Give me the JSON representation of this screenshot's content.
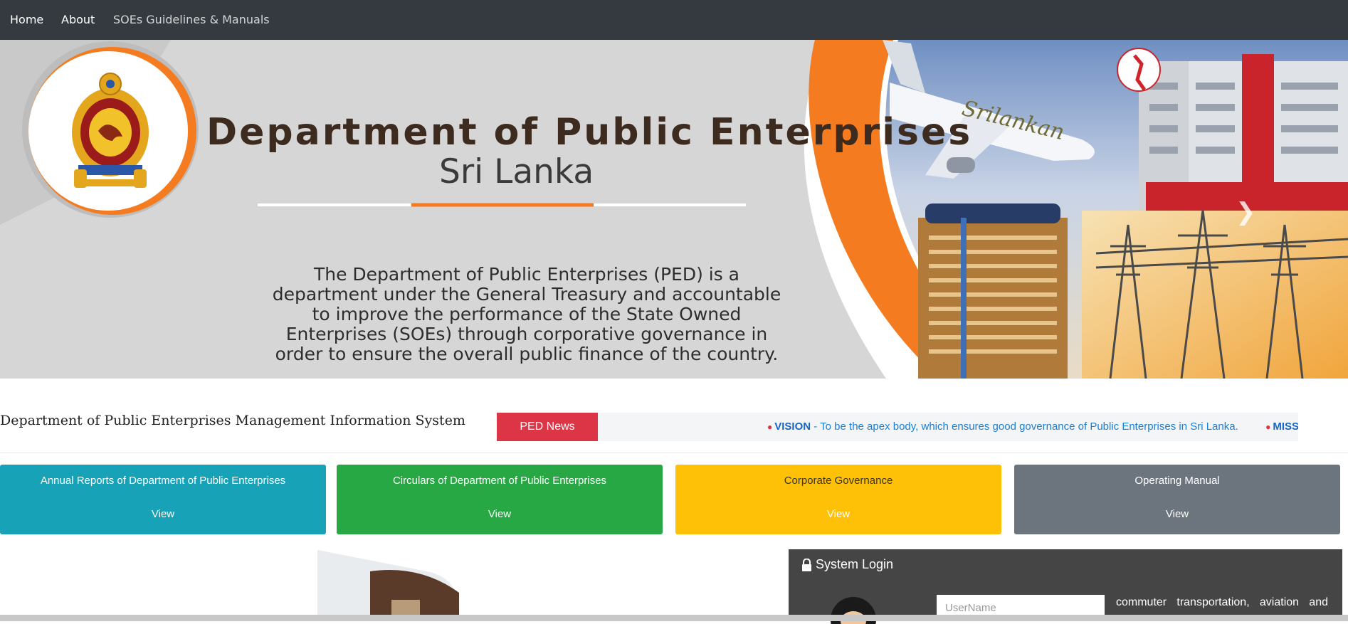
{
  "nav": {
    "items": [
      "Home",
      "About",
      "SOEs Guidelines & Manuals"
    ]
  },
  "banner": {
    "title": "Department of Public Enterprises",
    "subtitle": "Sri Lanka",
    "description": "The Department of Public Enterprises (PED) is a department under the General Treasury and accountable to improve the performance of the State Owned Enterprises (SOEs) through corporative governance in order to ensure the overall public finance of the country.",
    "plane_text": "Srilankan",
    "accent_color": "#f47b20"
  },
  "mis_title": "Department of Public Enterprises Management Information System",
  "news": {
    "label": "PED News",
    "items": [
      {
        "heading": "VISION",
        "text": " - To be the apex body, which ensures good governance of Public Enterprises in Sri Lanka."
      },
      {
        "heading": "MISSION",
        "text": ""
      }
    ]
  },
  "cards": [
    {
      "title": "Annual Reports of Department of Public Enterprises",
      "action": "View",
      "color": "#17a2b8"
    },
    {
      "title": "Circulars of Department of Public Enterprises",
      "action": "View",
      "color": "#28a745"
    },
    {
      "title": "Corporate Governance",
      "action": "View",
      "color": "#ffc107"
    },
    {
      "title": "Operating Manual",
      "action": "View",
      "color": "#6c757d"
    }
  ],
  "login": {
    "title": "System Login",
    "username_placeholder": "UserName",
    "text": "commuter transportation, aviation and"
  }
}
